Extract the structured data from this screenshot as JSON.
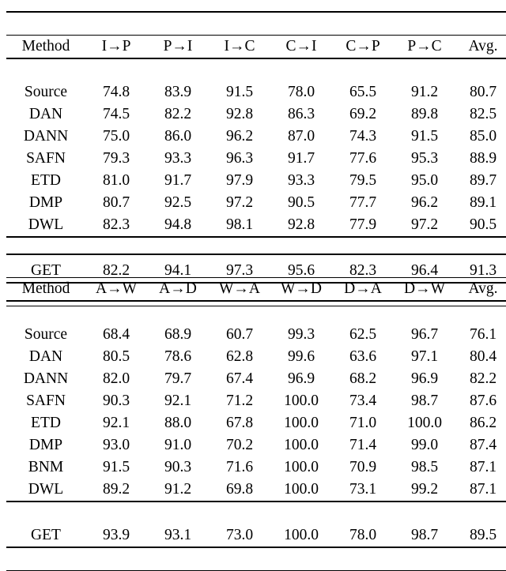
{
  "document": {
    "kind": "research-paper-results-tables",
    "clipped_caption_above": "",
    "bold_meaning": "best result in column"
  },
  "tables": [
    {
      "id": "image-clef-da",
      "columns": [
        "Method",
        "I→P",
        "P→I",
        "I→C",
        "C→I",
        "C→P",
        "P→C",
        "Avg."
      ],
      "rows": [
        {
          "method": "Source",
          "values": [
            "74.8",
            "83.9",
            "91.5",
            "78.0",
            "65.5",
            "91.2",
            "80.7"
          ],
          "bold": [
            false,
            false,
            false,
            false,
            false,
            false,
            false
          ]
        },
        {
          "method": "DAN",
          "values": [
            "74.5",
            "82.2",
            "92.8",
            "86.3",
            "69.2",
            "89.8",
            "82.5"
          ],
          "bold": [
            false,
            false,
            false,
            false,
            false,
            false,
            false
          ]
        },
        {
          "method": "DANN",
          "values": [
            "75.0",
            "86.0",
            "96.2",
            "87.0",
            "74.3",
            "91.5",
            "85.0"
          ],
          "bold": [
            false,
            false,
            false,
            false,
            false,
            false,
            false
          ]
        },
        {
          "method": "SAFN",
          "values": [
            "79.3",
            "93.3",
            "96.3",
            "91.7",
            "77.6",
            "95.3",
            "88.9"
          ],
          "bold": [
            false,
            false,
            false,
            false,
            false,
            false,
            false
          ]
        },
        {
          "method": "ETD",
          "values": [
            "81.0",
            "91.7",
            "97.9",
            "93.3",
            "79.5",
            "95.0",
            "89.7"
          ],
          "bold": [
            false,
            false,
            false,
            false,
            false,
            false,
            false
          ]
        },
        {
          "method": "DMP",
          "values": [
            "80.7",
            "92.5",
            "97.2",
            "90.5",
            "77.7",
            "96.2",
            "89.1"
          ],
          "bold": [
            false,
            false,
            false,
            false,
            false,
            false,
            false
          ]
        },
        {
          "method": "DWL",
          "values": [
            "82.3",
            "94.8",
            "98.1",
            "92.8",
            "77.9",
            "97.2",
            "90.5"
          ],
          "bold": [
            true,
            true,
            true,
            false,
            false,
            true,
            false
          ]
        }
      ],
      "summary": {
        "method": "GET",
        "values": [
          "82.2",
          "94.1",
          "97.3",
          "95.6",
          "82.3",
          "96.4",
          "91.3"
        ],
        "bold": [
          false,
          false,
          false,
          true,
          true,
          false,
          true
        ]
      }
    },
    {
      "id": "office31-da",
      "columns": [
        "Method",
        "A→W",
        "A→D",
        "W→A",
        "W→D",
        "D→A",
        "D→W",
        "Avg."
      ],
      "rows": [
        {
          "method": "Source",
          "values": [
            "68.4",
            "68.9",
            "60.7",
            "99.3",
            "62.5",
            "96.7",
            "76.1"
          ],
          "bold": [
            false,
            false,
            false,
            false,
            false,
            false,
            false
          ]
        },
        {
          "method": "DAN",
          "values": [
            "80.5",
            "78.6",
            "62.8",
            "99.6",
            "63.6",
            "97.1",
            "80.4"
          ],
          "bold": [
            false,
            false,
            false,
            false,
            false,
            false,
            false
          ]
        },
        {
          "method": "DANN",
          "values": [
            "82.0",
            "79.7",
            "67.4",
            "96.9",
            "68.2",
            "96.9",
            "82.2"
          ],
          "bold": [
            false,
            false,
            false,
            false,
            false,
            false,
            false
          ]
        },
        {
          "method": "SAFN",
          "values": [
            "90.3",
            "92.1",
            "71.2",
            "100.0",
            "73.4",
            "98.7",
            "87.6"
          ],
          "bold": [
            false,
            false,
            false,
            false,
            false,
            false,
            false
          ]
        },
        {
          "method": "ETD",
          "values": [
            "92.1",
            "88.0",
            "67.8",
            "100.0",
            "71.0",
            "100.0",
            "86.2"
          ],
          "bold": [
            false,
            false,
            false,
            false,
            false,
            true,
            false
          ]
        },
        {
          "method": "DMP",
          "values": [
            "93.0",
            "91.0",
            "70.2",
            "100.0",
            "71.4",
            "99.0",
            "87.4"
          ],
          "bold": [
            false,
            false,
            false,
            false,
            false,
            false,
            false
          ]
        },
        {
          "method": "BNM",
          "values": [
            "91.5",
            "90.3",
            "71.6",
            "100.0",
            "70.9",
            "98.5",
            "87.1"
          ],
          "bold": [
            false,
            false,
            false,
            false,
            false,
            false,
            false
          ]
        },
        {
          "method": "DWL",
          "values": [
            "89.2",
            "91.2",
            "69.8",
            "100.0",
            "73.1",
            "99.2",
            "87.1"
          ],
          "bold": [
            false,
            false,
            false,
            false,
            false,
            false,
            false
          ]
        }
      ],
      "summary": {
        "method": "GET",
        "values": [
          "93.9",
          "93.1",
          "73.0",
          "100.0",
          "78.0",
          "98.7",
          "89.5"
        ],
        "bold": [
          true,
          true,
          true,
          true,
          true,
          false,
          true
        ]
      }
    }
  ]
}
